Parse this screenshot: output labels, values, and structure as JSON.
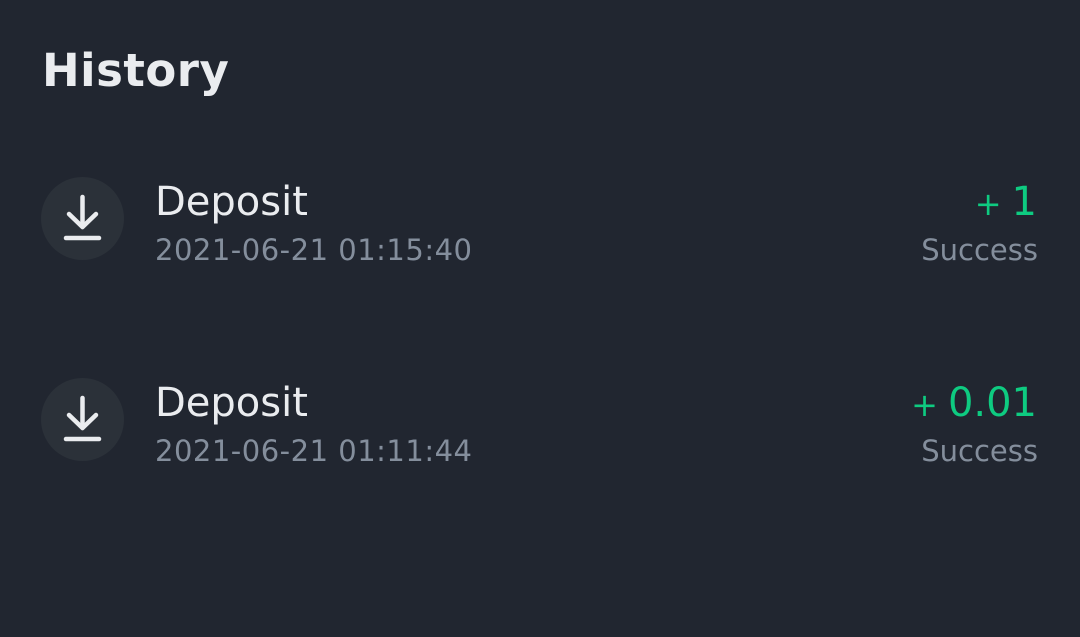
{
  "header": {
    "title": "History"
  },
  "history": {
    "items": [
      {
        "type": "Deposit",
        "timestamp": "2021-06-21 01:15:40",
        "amount_sign": "+",
        "amount_value": "1",
        "status": "Success",
        "icon": "download-icon"
      },
      {
        "type": "Deposit",
        "timestamp": "2021-06-21 01:11:44",
        "amount_sign": "+",
        "amount_value": "0.01",
        "status": "Success",
        "icon": "download-icon"
      }
    ]
  },
  "colors": {
    "background": "#212630",
    "text_primary": "#EAECEF",
    "text_secondary": "#848E9C",
    "positive": "#0ECB81",
    "icon_circle": "#2B3139"
  }
}
